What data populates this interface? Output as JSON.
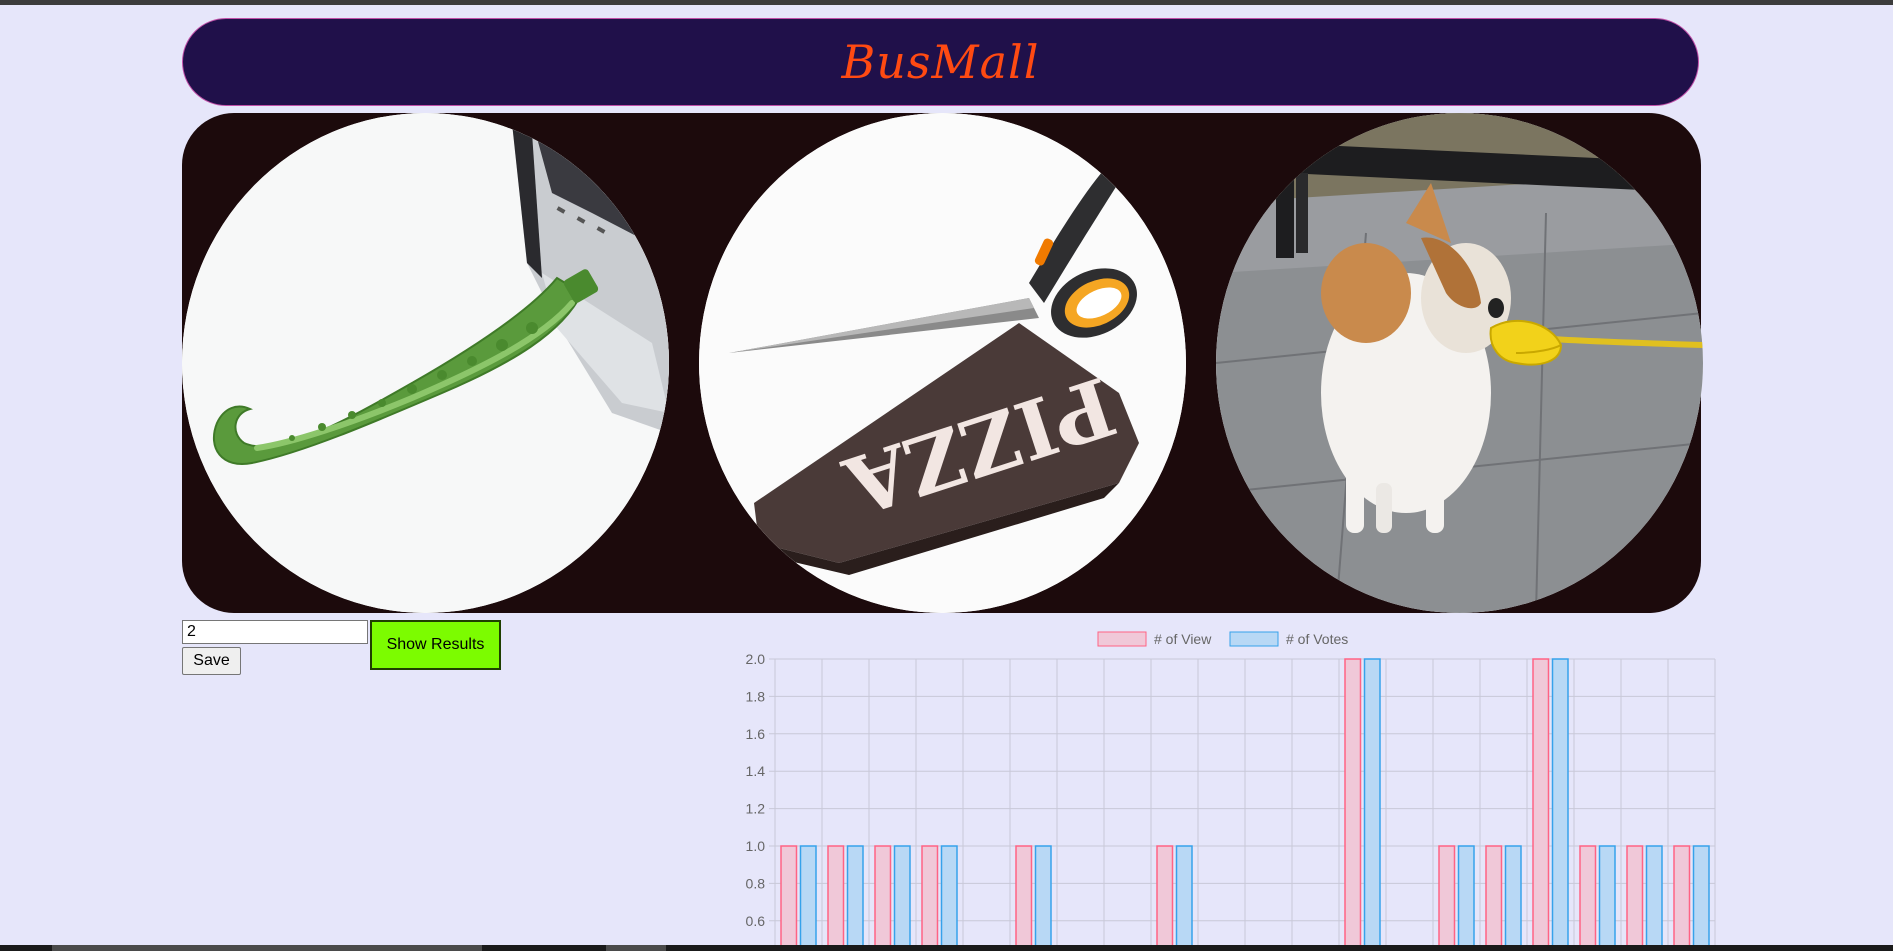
{
  "app": {
    "title": "BusMall"
  },
  "products": [
    {
      "name": "usb-tentacle"
    },
    {
      "name": "pizza-scissors"
    },
    {
      "name": "dog-duck-muzzle"
    }
  ],
  "controls": {
    "input_value": "2",
    "save_label": "Save",
    "show_results_label": "Show Results"
  },
  "colors": {
    "banner_bg": "#20104a",
    "title_color": "#ff4a12",
    "results_button": "#7cfc00",
    "view_fill": "#f0c8d8",
    "view_border": "#ff6384",
    "vote_fill": "#b8d8f5",
    "vote_border": "#36a2eb"
  },
  "chart_data": {
    "type": "bar",
    "legend_position": "top",
    "grid": true,
    "ylim": [
      0,
      2.0
    ],
    "visible_ylim": [
      0.5,
      2.0
    ],
    "yticks": [
      "2.0",
      "1.8",
      "1.6",
      "1.4",
      "1.2",
      "1.0",
      "0.8",
      "0.6"
    ],
    "series": [
      {
        "name": "# of View",
        "values": [
          1,
          1,
          1,
          1,
          0,
          1,
          0,
          0,
          1,
          0,
          0,
          0,
          2,
          0,
          1,
          1,
          2,
          1,
          1,
          1
        ]
      },
      {
        "name": "# of Votes",
        "values": [
          1,
          1,
          1,
          1,
          0,
          1,
          0,
          0,
          1,
          0,
          0,
          0,
          2,
          0,
          1,
          1,
          2,
          1,
          1,
          1
        ]
      }
    ]
  }
}
